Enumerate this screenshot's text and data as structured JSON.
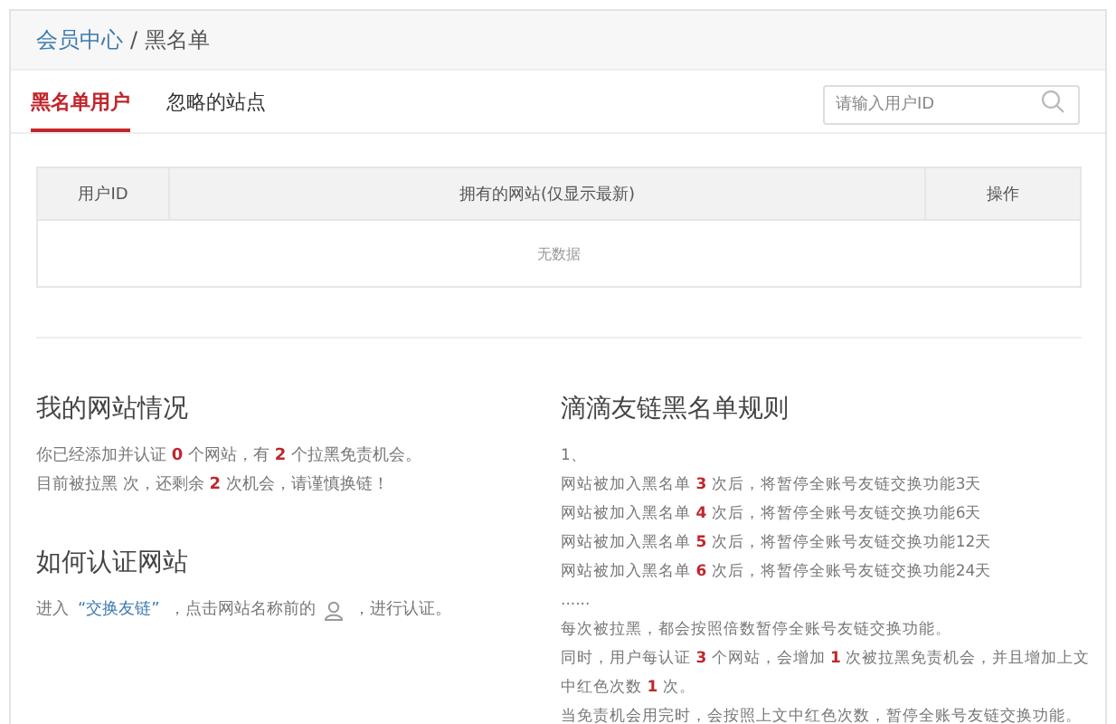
{
  "breadcrumb": {
    "link": "会员中心",
    "separator": "/",
    "current": "黑名单"
  },
  "tabs": [
    {
      "label": "黑名单用户",
      "selected": true
    },
    {
      "label": "忽略的站点",
      "selected": false
    }
  ],
  "search": {
    "placeholder": "请输入用户ID"
  },
  "table": {
    "columns": [
      "用户ID",
      "拥有的网站(仅显示最新)",
      "操作"
    ],
    "empty": "无数据"
  },
  "my_sites": {
    "title": "我的网站情况",
    "lines": [
      "你已经添加并认证 **0** 个网站，有 **2** 个拉黑免责机会。",
      "目前被拉黑  次，还剩余 **2** 次机会，请谨慎换链！"
    ]
  },
  "verify": {
    "title": "如何认证网站",
    "before": "进入",
    "link": "“交换友链”",
    "middle": "，点击网站名称前的",
    "after": "，进行认证。"
  },
  "rules": {
    "title": "滴滴友链黑名单规则",
    "lines": [
      "1、",
      "网站被加入黑名单 **3** 次后，将暂停全账号友链交换功能3天",
      "网站被加入黑名单 **4** 次后，将暂停全账号友链交换功能6天",
      "网站被加入黑名单 **5** 次后，将暂停全账号友链交换功能12天",
      "网站被加入黑名单 **6** 次后，将暂停全账号友链交换功能24天",
      "......",
      "每次被拉黑，都会按照倍数暂停全账号友链交换功能。",
      "同时，用户每认证 **3** 个网站，会增加 **1** 次被拉黑免责机会，并且增加上文中红色次数 **1** 次。",
      "当免责机会用完时，会按照上文中红色次数，暂停全账号友链交换功能。"
    ]
  }
}
